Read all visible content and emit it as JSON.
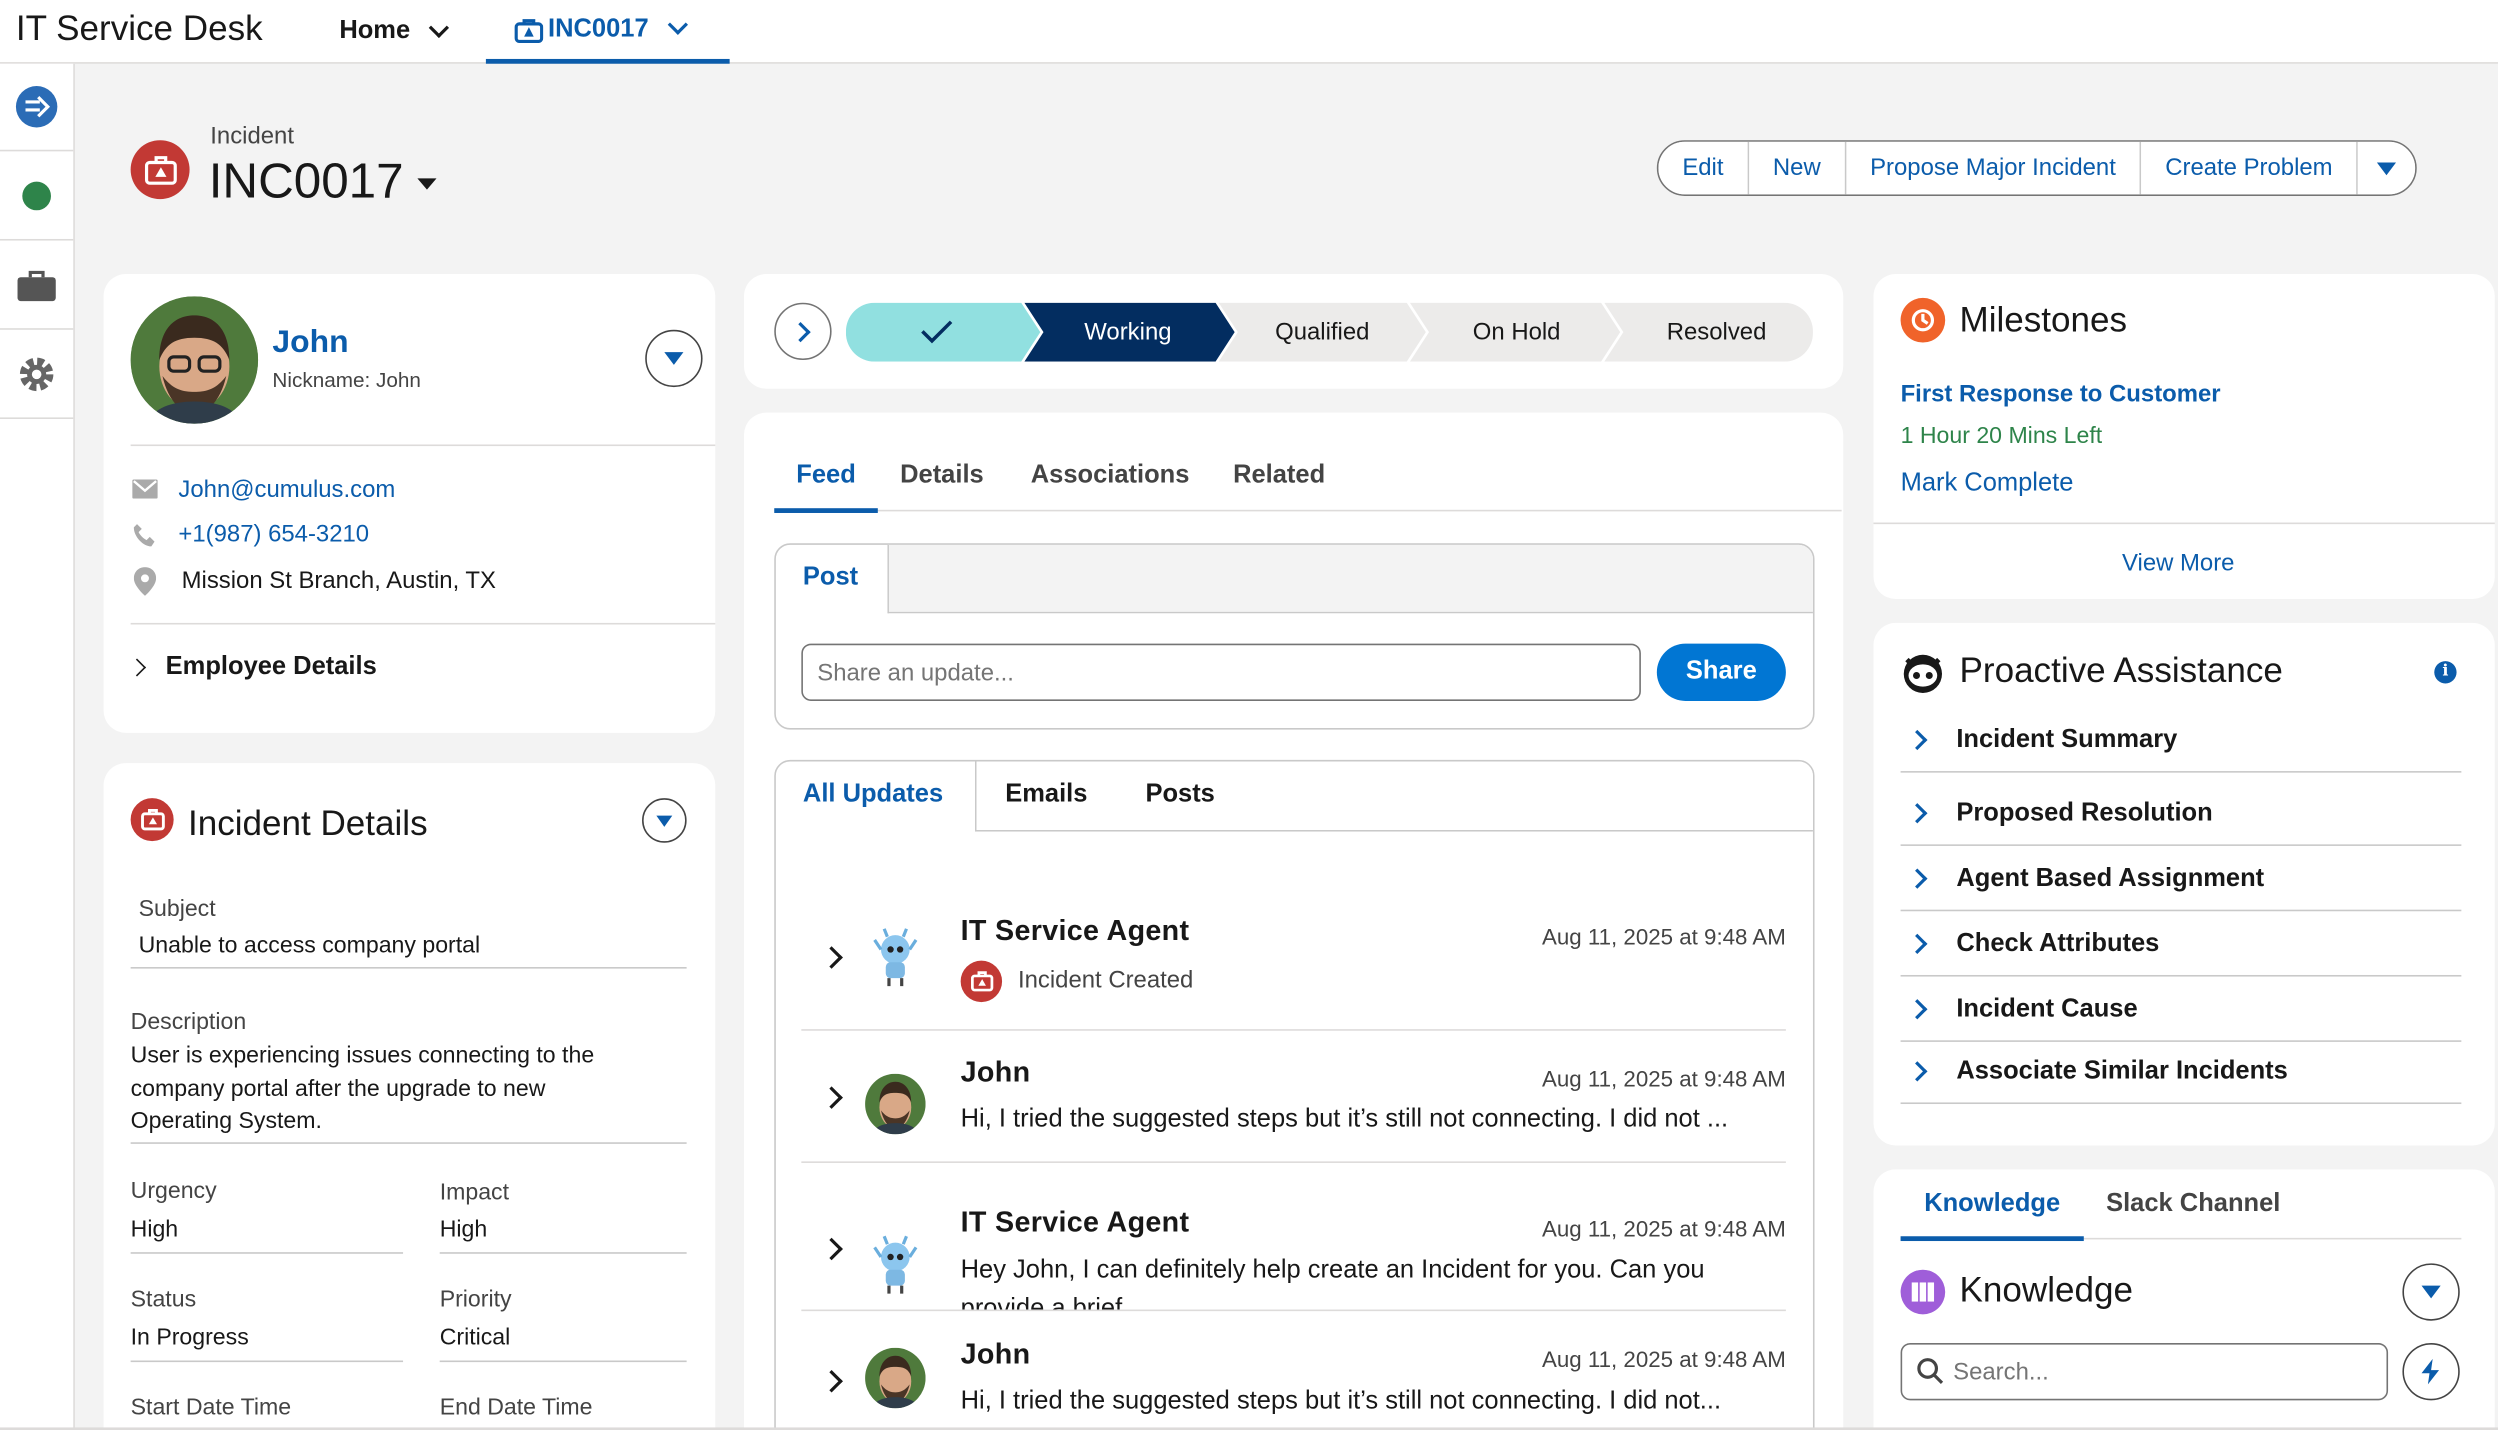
{
  "app": {
    "name": "IT Service Desk"
  },
  "nav": {
    "tabs": [
      {
        "label": "Home"
      },
      {
        "label": "INC0017"
      }
    ]
  },
  "rail": {
    "icons": [
      "forward-icon",
      "status-dot-icon",
      "briefcase-icon",
      "gear-icon"
    ]
  },
  "header": {
    "object_type": "Incident",
    "record_name": "INC0017",
    "actions": [
      "Edit",
      "New",
      "Propose Major Incident",
      "Create Problem"
    ]
  },
  "contact": {
    "name": "John",
    "nickname": "Nickname: John",
    "email": "John@cumulus.com",
    "phone": "+1(987) 654-3210",
    "location": "Mission St Branch, Austin, TX",
    "section_label": "Employee Details"
  },
  "incident_details": {
    "title": "Incident Details",
    "subject_label": "Subject",
    "subject_value": "Unable to access company portal",
    "description_label": "Description",
    "description_lines": [
      "User is experiencing issues connecting to the",
      "company portal after the upgrade to new",
      "Operating System."
    ],
    "urgency_label": "Urgency",
    "urgency_value": "High",
    "impact_label": "Impact",
    "impact_value": "High",
    "status_label": "Status",
    "status_value": "In Progress",
    "priority_label": "Priority",
    "priority_value": "Critical",
    "start_label": "Start Date Time",
    "end_label": "End Date Time"
  },
  "path": {
    "steps": [
      "Working",
      "Qualified",
      "On Hold",
      "Resolved"
    ],
    "current": "Working",
    "completed_icon": "checkmark-icon"
  },
  "feed_tabs": [
    "Feed",
    "Details",
    "Associations",
    "Related"
  ],
  "publisher": {
    "tab": "Post",
    "placeholder": "Share an update...",
    "share_label": "Share"
  },
  "filter_tabs": [
    "All Updates",
    "Emails",
    "Posts"
  ],
  "feed_items": [
    {
      "author": "IT Service Agent",
      "time": "Aug 11, 2025 at 9:48 AM",
      "text": "Incident Created"
    },
    {
      "author": "John",
      "time": "Aug 11, 2025 at 9:48 AM",
      "text": "Hi, I tried the suggested steps but it’s still not connecting. I did not ..."
    },
    {
      "author": "IT Service Agent",
      "time": "Aug 11, 2025 at 9:48 AM",
      "text": "Hey John, I can definitely help create an Incident for you. Can you",
      "text2": "provide a brief"
    },
    {
      "author": "John",
      "time": "Aug 11, 2025 at 9:48 AM",
      "text": "Hi, I tried the suggested steps but it’s still not connecting. I did not..."
    }
  ],
  "milestones": {
    "title": "Milestones",
    "name": "First Response to Customer",
    "time_left": "1 Hour 20 Mins Left",
    "complete_label": "Mark Complete",
    "view_more": "View More"
  },
  "proactive": {
    "title": "Proactive Assistance",
    "items": [
      "Incident Summary",
      "Proposed Resolution",
      "Agent Based Assignment",
      "Check Attributes",
      "Incident Cause",
      "Associate Similar Incidents"
    ]
  },
  "knowledge": {
    "tabs": [
      "Knowledge",
      "Slack Channel"
    ],
    "title": "Knowledge",
    "search_placeholder": "Search..."
  },
  "colors": {
    "brand_blue": "#0b5cab",
    "path_current": "#032d60",
    "path_complete": "#91e0e0",
    "incident_icon": "#c23934",
    "milestone_orange": "#f0632a",
    "time_left_green": "#2e844a",
    "knowledge_purple": "#9f5ed9",
    "share_button": "#0176d3"
  }
}
